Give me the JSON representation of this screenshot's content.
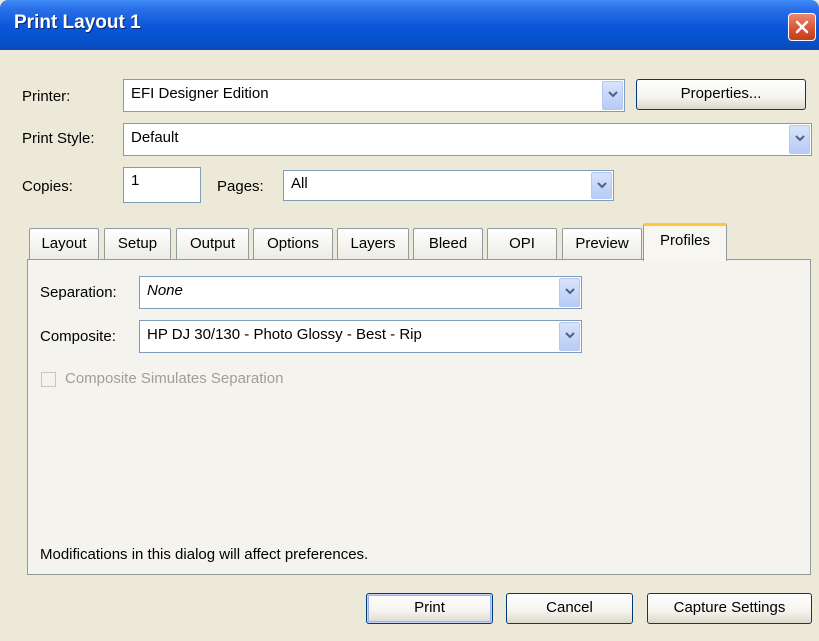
{
  "window": {
    "title": "Print Layout 1"
  },
  "printer": {
    "label": "Printer:",
    "value": "EFI Designer Edition",
    "properties_button": "Properties..."
  },
  "print_style": {
    "label": "Print Style:",
    "value": "Default"
  },
  "copies": {
    "label": "Copies:",
    "value": "1"
  },
  "pages": {
    "label": "Pages:",
    "value": "All"
  },
  "tabs": [
    "Layout",
    "Setup",
    "Output",
    "Options",
    "Layers",
    "Bleed",
    "OPI",
    "Preview",
    "Profiles"
  ],
  "active_tab": "Profiles",
  "profiles": {
    "separation_label": "Separation:",
    "separation_value": "None",
    "composite_label": "Composite:",
    "composite_value": "HP DJ 30/130 - Photo Glossy - Best - Rip",
    "simulate_checkbox": "Composite Simulates Separation",
    "simulate_checked": false
  },
  "status_note": "Modifications in this dialog will affect preferences.",
  "buttons": {
    "print": "Print",
    "cancel": "Cancel",
    "capture": "Capture Settings"
  }
}
